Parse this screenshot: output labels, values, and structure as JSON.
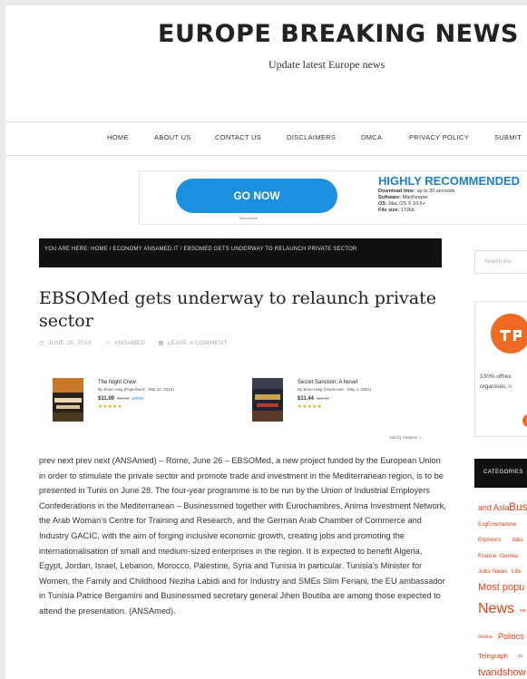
{
  "header": {
    "site_title": "EUROPE BREAKING NEWS",
    "site_description": "Update latest Europe news"
  },
  "nav": {
    "items": [
      "HOME",
      "ABOUT US",
      "CONTACT US",
      "DISCLAIMERS",
      "DMCA",
      "PRIVACY POLICY",
      "SUBMIT"
    ]
  },
  "ad": {
    "button_label": "GO NOW",
    "maker": "MacKeeper",
    "headline": "HIGHLY RECOMMENDED",
    "download_label": "Download time:",
    "download_value": "up to 20 seconds",
    "software_label": "Software:",
    "software_value": "MacKeeper",
    "os_label": "OS:",
    "os_value": "Mac OS X 10.5+",
    "filesize_label": "File size:",
    "filesize_value": "172kb"
  },
  "breadcrumb": {
    "text": "YOU ARE HERE: HOME / ECONOMY ANSAMED.IT / EBSOMED GETS UNDERWAY TO RELAUNCH PRIVATE SECTOR"
  },
  "article": {
    "title": "EBSOMed gets underway to relaunch private sector",
    "date": "JUNE 26, 2018",
    "author": "ANSAMED",
    "comment_link": "LEAVE A COMMENT",
    "body": "prev next prev next (ANSAmed) – Rome, June 26 – EBSOMed, a new project funded by the European Union in order to stimulate the private sector and promote trade and investment in the Mediterranean region, is to be presented in Tunis on June 28. The four-year programme is to be run by the Union of Industrial Employers Confederations in the Mediterranean – Businessmed together with Eurochambres, Anima Investment Network, the Arab Woman's Centre for Training and Research, and the German Arab Chamber of Commerce and Industry GACIC, with the aim of forging inclusive economic growth, creating jobs and promoting the internationalisation of small and medium-sized enterprises in the region. It is expected to benefit Algeria, Egypt, Jordan, Israel, Lebanon, Morocco, Palestine, Syria and Tunisia in particular. Tunisia's Minister for Women, the Family and Childhood Neziha Labidi and for Industry and SMEs Slim Feriani, the EU ambassador in Tunisia Patrice Bergamini and Businessmed secretary general Jihen Boutiba are among those expected to attend the presentation. (ANSAmed)."
  },
  "books": [
    {
      "title": "The Night Crew",
      "author": "By Brian Haig (Paperback - Mar 10, 2015)",
      "price": "$11.09",
      "list_price": "$15.66",
      "prime": "prime",
      "rating": 4.5,
      "stars": "★★★★★"
    },
    {
      "title": "Secret Sanction: A Novel",
      "author": "By Brian Haig (Hardcover - May 1, 2001)",
      "price": "$11.44",
      "list_price": "$24.40",
      "rating": 4.5,
      "stars": "★★★★★"
    }
  ],
  "ads_by": "Ads by Amazon",
  "sidebar": {
    "search_placeholder": "Search this",
    "promo_text_1": "100% offres",
    "promo_text_2": "organisés, c",
    "categories_header": "CATEGORIES",
    "tags": [
      "and Asia",
      "Busi",
      "Esg",
      "Entertainme",
      "Explorers",
      "fabu",
      "France",
      "Germa",
      "Jobs",
      "News",
      "Life",
      "Most popu",
      "News",
      "net",
      "Online",
      "Politics",
      "Telegraph",
      "tu",
      "tvandshow"
    ]
  },
  "colors": {
    "ad_blue": "#1b8fe0",
    "tag_orange": "#e8401b",
    "tp_orange": "#ef6a22",
    "star_gold": "#f0a300"
  }
}
